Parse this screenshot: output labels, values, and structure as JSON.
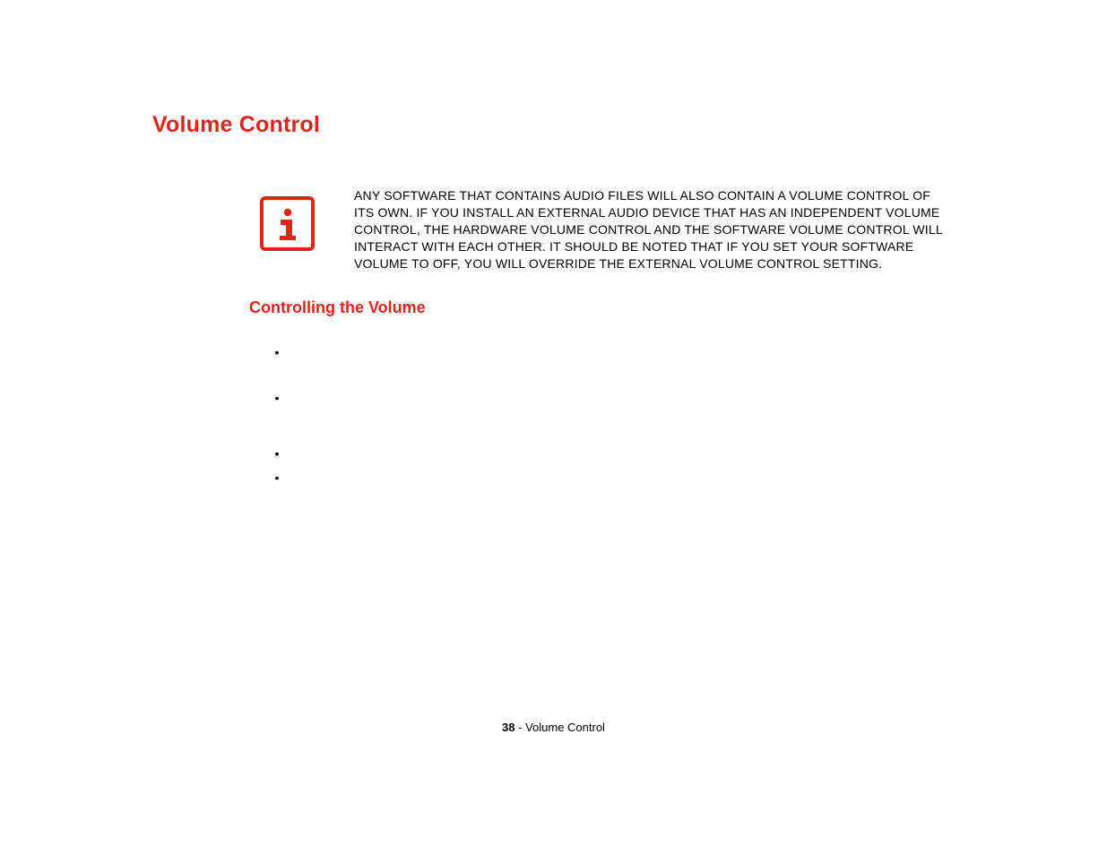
{
  "title": "Volume Control",
  "info_note": "ANY SOFTWARE THAT CONTAINS AUDIO FILES WILL ALSO CONTAIN A VOLUME CONTROL OF ITS OWN. IF YOU INSTALL AN EXTERNAL AUDIO DEVICE THAT HAS AN INDEPENDENT VOLUME CONTROL, THE HARDWARE VOLUME CONTROL AND THE SOFTWARE VOLUME CONTROL WILL INTERACT WITH EACH OTHER. IT SHOULD BE NOTED THAT IF YOU SET YOUR SOFTWARE VOLUME TO OFF, YOU WILL OVERRIDE THE EXTERNAL VOLUME CONTROL SETTING.",
  "sub_heading": "Controlling the Volume",
  "bullets": [
    "",
    "",
    "",
    ""
  ],
  "footer": {
    "page_number": "38",
    "separator": " - ",
    "section": "Volume Control"
  }
}
